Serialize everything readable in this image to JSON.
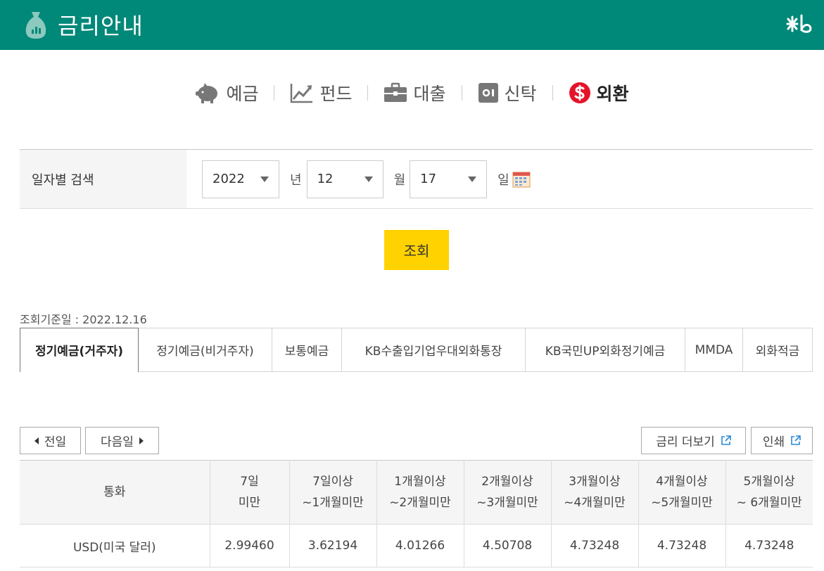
{
  "header": {
    "title": "금리안내"
  },
  "categories": [
    {
      "label": "예금",
      "icon": "piggy-bank-icon"
    },
    {
      "label": "펀드",
      "icon": "trend-chart-icon"
    },
    {
      "label": "대출",
      "icon": "briefcase-icon"
    },
    {
      "label": "신탁",
      "icon": "safe-icon"
    },
    {
      "label": "외환",
      "icon": "dollar-icon",
      "active": true
    }
  ],
  "search": {
    "label": "일자별 검색",
    "year": "2022",
    "year_unit": "년",
    "month": "12",
    "month_unit": "월",
    "day": "17",
    "day_unit": "일"
  },
  "query_label": "조회",
  "basis_date": "조회기준일 : 2022.12.16",
  "tabs": [
    {
      "label": "정기예금(거주자)",
      "active": true
    },
    {
      "label": "정기예금(비거주자)"
    },
    {
      "label": "보통예금"
    },
    {
      "label": "KB수출입기업우대외화통장"
    },
    {
      "label": "KB국민UP외화정기예금"
    },
    {
      "label": "MMDA"
    },
    {
      "label": "외화적금"
    }
  ],
  "nav": {
    "prev": "전일",
    "next": "다음일",
    "more": "금리 더보기",
    "print": "인쇄"
  },
  "table": {
    "headers": [
      {
        "l1": "통화",
        "l2": ""
      },
      {
        "l1": "7일",
        "l2": "미만"
      },
      {
        "l1": "7일이상",
        "l2": "~1개월미만"
      },
      {
        "l1": "1개월이상",
        "l2": "~2개월미만"
      },
      {
        "l1": "2개월이상",
        "l2": "~3개월미만"
      },
      {
        "l1": "3개월이상",
        "l2": "~4개월미만"
      },
      {
        "l1": "4개월이상",
        "l2": "~5개월미만"
      },
      {
        "l1": "5개월이상",
        "l2": "~ 6개월미만"
      }
    ],
    "rows": [
      [
        "USD(미국 달러)",
        "2.99460",
        "3.62194",
        "4.01266",
        "4.50708",
        "4.73248",
        "4.73248",
        "4.73248"
      ]
    ]
  },
  "colors": {
    "header_bg": "#008878",
    "query_button": "#ffd200",
    "dollar_icon": "#e5132a"
  }
}
